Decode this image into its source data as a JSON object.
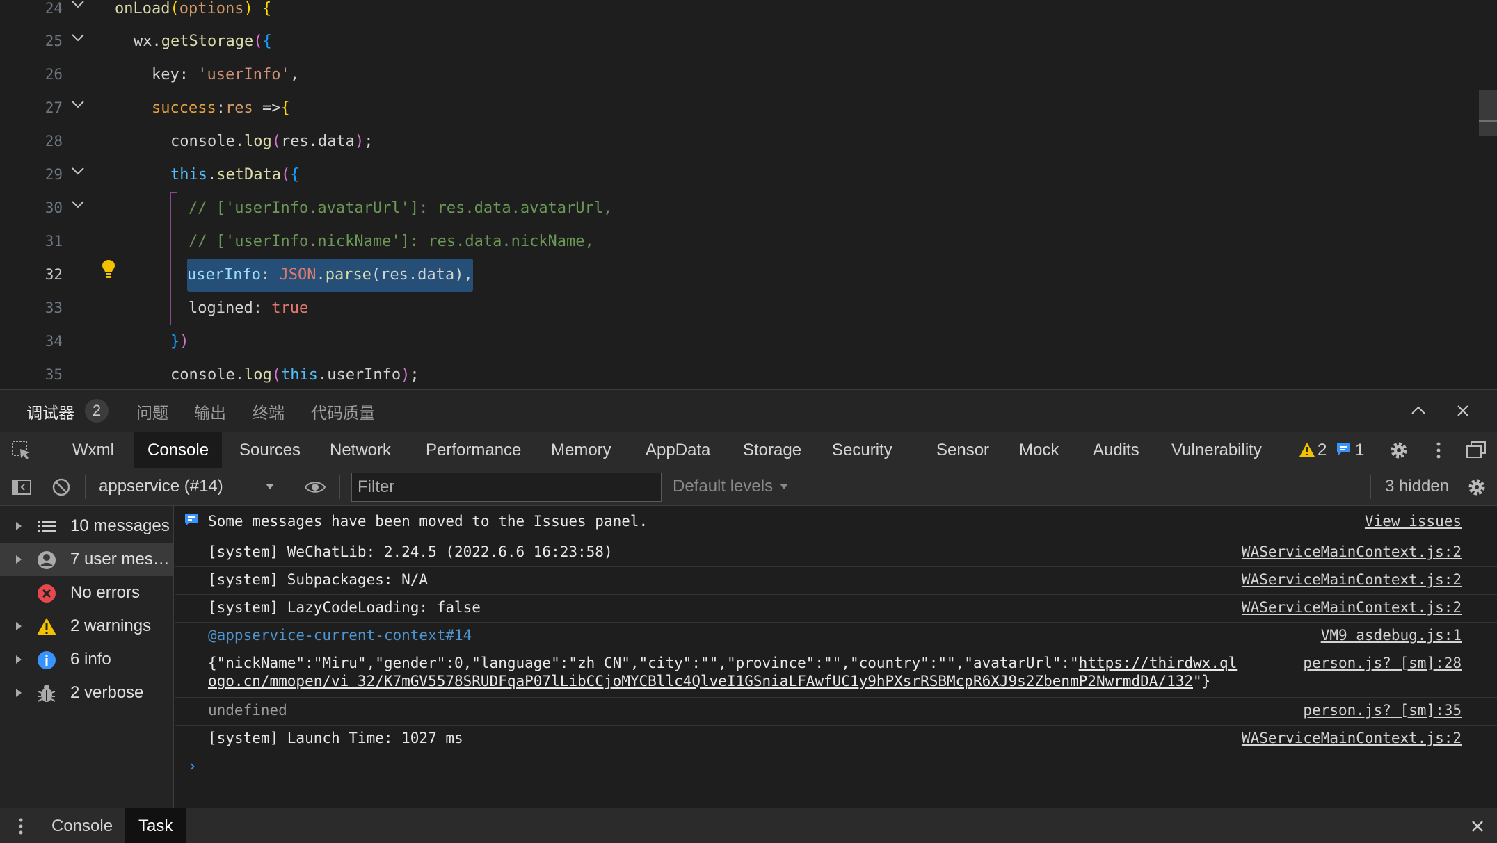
{
  "editor": {
    "gutter": [
      "24",
      "25",
      "26",
      "27",
      "28",
      "29",
      "30",
      "31",
      "32",
      "33",
      "34",
      "35"
    ],
    "active_line": "32"
  },
  "panel": {
    "tabs": [
      "调试器",
      "问题",
      "输出",
      "终端",
      "代码质量"
    ],
    "debugger_badge": "2"
  },
  "devtools": {
    "tabs": [
      "Wxml",
      "Console",
      "Sources",
      "Network",
      "Performance",
      "Memory",
      "AppData",
      "Storage",
      "Security",
      "Sensor",
      "Mock",
      "Audits",
      "Vulnerability"
    ],
    "active_tab": "Console",
    "warning_count": "2",
    "issue_count": "1"
  },
  "toolbar": {
    "context": "appservice (#14)",
    "filter_placeholder": "Filter",
    "levels": "Default levels",
    "hidden": "3 hidden"
  },
  "sidebar": {
    "items": [
      {
        "label": "10 messages",
        "icon": "list-icon"
      },
      {
        "label": "7 user mess…",
        "icon": "user-icon"
      },
      {
        "label": "No errors",
        "icon": "error-icon"
      },
      {
        "label": "2 warnings",
        "icon": "warning-icon"
      },
      {
        "label": "6 info",
        "icon": "info-icon"
      },
      {
        "label": "2 verbose",
        "icon": "bug-icon"
      }
    ]
  },
  "console": {
    "messages": [
      {
        "text": "Some messages have been moved to the Issues panel.",
        "source": "View issues"
      },
      {
        "text": "[system] WeChatLib: 2.24.5 (2022.6.6 16:23:58)",
        "source": "WAServiceMainContext.js:2"
      },
      {
        "text": "[system] Subpackages: N/A",
        "source": "WAServiceMainContext.js:2"
      },
      {
        "text": "[system] LazyCodeLoading: false",
        "source": "WAServiceMainContext.js:2"
      },
      {
        "text": "@appservice-current-context#14",
        "source": "VM9 asdebug.js:1"
      },
      {
        "text_a": "{\"nickName\":\"Miru\",\"gender\":0,\"language\":\"zh_CN\",\"city\":\"\",\"province\":\"\",\"country\":\"\",\"avatarUrl\":\"",
        "url_a": "https://thirdwx.ql",
        "url_b": "ogo.cn/mmopen/vi_32/K7mGV5578SRUDFqaP07lLibCCjoMYCBllc4QlveI1GSniaLFAwfUC1y9hPXsrRSBMcpR6XJ9s2ZbenmP2NwrmdDA/132",
        "text_b": "\"}",
        "source": "person.js? [sm]:28"
      },
      {
        "text": "undefined",
        "source": "person.js? [sm]:35"
      },
      {
        "text": "[system] Launch Time: 1027 ms",
        "source": "WAServiceMainContext.js:2"
      }
    ],
    "prompt": "›"
  },
  "drawer": {
    "tabs": [
      "Console",
      "Task"
    ],
    "active": "Task"
  },
  "colors": {
    "editor_bg": "#1e1e1e",
    "panel_bg": "#2b2b2b",
    "selection": "#264f78",
    "link_blue": "#3794ff",
    "warning": "#f2c200",
    "error": "#e5484d"
  }
}
